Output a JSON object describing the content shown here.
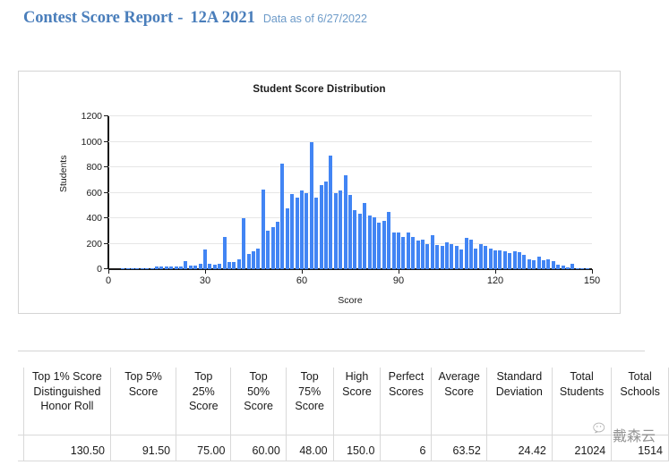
{
  "header": {
    "title_main": "Contest Score Report",
    "dash": "-",
    "title_sub": "12A 2021",
    "as_of": "Data as of 6/27/2022",
    "title_color": "#4a7ebb"
  },
  "chart_panel": {
    "title": "Student Score Distribution"
  },
  "chart_data": {
    "type": "bar",
    "title": "Student Score Distribution",
    "xlabel": "Score",
    "ylabel": "Students",
    "xlim": [
      0,
      150
    ],
    "ylim": [
      0,
      1200
    ],
    "xticks": [
      0,
      30,
      60,
      90,
      120,
      150
    ],
    "yticks": [
      0,
      200,
      400,
      600,
      800,
      1000,
      1200
    ],
    "grid": true,
    "legend": "none",
    "bar_color": "#4285f4",
    "bin_width": 1.5,
    "categories": [
      0,
      1.5,
      3,
      4.5,
      6,
      7.5,
      9,
      10.5,
      12,
      13.5,
      15,
      16.5,
      18,
      19.5,
      21,
      22.5,
      24,
      25.5,
      27,
      28.5,
      30,
      31.5,
      33,
      34.5,
      36,
      37.5,
      39,
      40.5,
      42,
      43.5,
      45,
      46.5,
      48,
      49.5,
      51,
      52.5,
      54,
      55.5,
      57,
      58.5,
      60,
      61.5,
      63,
      64.5,
      66,
      67.5,
      69,
      70.5,
      72,
      73.5,
      75,
      76.5,
      78,
      79.5,
      81,
      82.5,
      84,
      85.5,
      87,
      88.5,
      90,
      91.5,
      93,
      94.5,
      96,
      97.5,
      99,
      100.5,
      102,
      103.5,
      105,
      106.5,
      108,
      109.5,
      111,
      112.5,
      114,
      115.5,
      117,
      118.5,
      120,
      121.5,
      123,
      124.5,
      126,
      127.5,
      129,
      130.5,
      132,
      133.5,
      135,
      136.5,
      138,
      139.5,
      141,
      142.5,
      144,
      145.5,
      147,
      148.5,
      150
    ],
    "values": [
      0,
      0,
      0,
      6,
      10,
      8,
      4,
      2,
      2,
      2,
      20,
      18,
      22,
      18,
      20,
      20,
      60,
      28,
      26,
      42,
      155,
      40,
      36,
      45,
      250,
      56,
      58,
      80,
      400,
      120,
      140,
      160,
      625,
      300,
      330,
      370,
      825,
      475,
      590,
      560,
      615,
      600,
      1000,
      565,
      660,
      690,
      890,
      600,
      620,
      735,
      585,
      465,
      435,
      520,
      420,
      410,
      365,
      380,
      450,
      290,
      290,
      255,
      285,
      255,
      225,
      230,
      200,
      265,
      190,
      180,
      210,
      195,
      185,
      155,
      245,
      235,
      165,
      200,
      185,
      160,
      145,
      150,
      140,
      125,
      140,
      130,
      115,
      75,
      70,
      95,
      70,
      80,
      60,
      35,
      25,
      15,
      40,
      10,
      6,
      4,
      0
    ]
  },
  "divider": {},
  "table": {
    "headers": [
      "Top 1% Score Distinguished Honor Roll",
      "Top 5% Score",
      "Top 25% Score",
      "Top 50% Score",
      "Top 75% Score",
      "High Score",
      "Perfect Scores",
      "Average Score",
      "Standard Deviation",
      "Total Students",
      "Total Schools"
    ],
    "row": [
      "130.50",
      "91.50",
      "75.00",
      "60.00",
      "48.00",
      "150.0",
      "6",
      "63.52",
      "24.42",
      "21024",
      "1514"
    ]
  },
  "watermark": {
    "text": "戴森云",
    "logo": "wechat-icon"
  }
}
